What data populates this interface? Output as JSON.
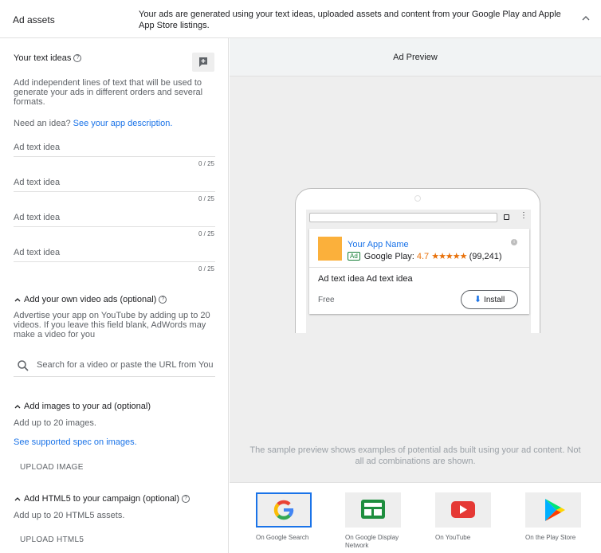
{
  "header": {
    "title": "Ad assets",
    "description": "Your ads are generated using your text ideas, uploaded assets and content from your Google Play and Apple App Store listings."
  },
  "text_ideas": {
    "title": "Your text ideas",
    "description": "Add independent lines of text that will be used to generate your ads in different orders and several formats.",
    "idea_prompt": "Need an idea?",
    "idea_link": "See your app description.",
    "fields": [
      {
        "placeholder": "Ad text idea",
        "counter": "0 / 25"
      },
      {
        "placeholder": "Ad text idea",
        "counter": "0 / 25"
      },
      {
        "placeholder": "Ad text idea",
        "counter": "0 / 25"
      },
      {
        "placeholder": "Ad text idea",
        "counter": "0 / 25"
      }
    ]
  },
  "video": {
    "title": "Add your own video ads (optional)",
    "description": "Advertise your app on YouTube by adding up to 20 videos. If you leave this field blank, AdWords may make a video for you",
    "search_placeholder": "Search for a video or paste the URL from You..."
  },
  "images": {
    "title": "Add images to your ad (optional)",
    "description": "Add up to 20 images.",
    "link": "See supported spec on images.",
    "upload_label": "UPLOAD IMAGE"
  },
  "html5": {
    "title": "Add HTML5 to your campaign (optional)",
    "description": "Add up to 20 HTML5 assets.",
    "upload_label": "UPLOAD HTML5"
  },
  "preview": {
    "title": "Ad Preview",
    "app_name": "Your App Name",
    "badge": "Ad",
    "store_label": "Google Play:",
    "rating": "4.7",
    "stars": "★★★★★",
    "reviews": "(99,241)",
    "ad_text": "Ad text idea Ad text idea",
    "price": "Free",
    "install_label": "Install",
    "note": "The sample preview shows examples of potential ads built using your ad content. Not all ad combinations are shown."
  },
  "networks": [
    {
      "label": "On Google Search",
      "icon": "google-g-icon",
      "selected": true
    },
    {
      "label": "On Google Display Network",
      "icon": "display-network-icon",
      "selected": false
    },
    {
      "label": "On YouTube",
      "icon": "youtube-icon",
      "selected": false
    },
    {
      "label": "On the Play Store",
      "icon": "play-store-icon",
      "selected": false
    }
  ],
  "colors": {
    "accent": "#1a73e8",
    "app_icon": "#fbb03b",
    "rating": "#e8710a",
    "badge": "#188038"
  }
}
